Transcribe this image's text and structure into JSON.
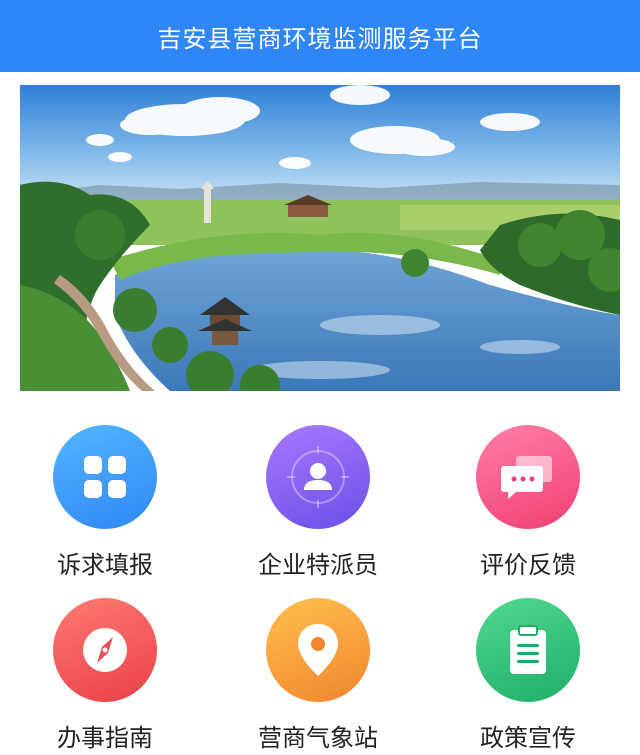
{
  "header": {
    "title": "吉安县营商环境监测服务平台",
    "color": "#2f86f6"
  },
  "banner": {
    "slide_index": 1,
    "slide_count": 1
  },
  "menu": [
    {
      "label": "诉求填报",
      "icon": "grid-icon",
      "color": "#2f86f6"
    },
    {
      "label": "企业特派员",
      "icon": "person-icon",
      "color": "#7b5cf0"
    },
    {
      "label": "评价反馈",
      "icon": "chat-icon",
      "color": "#f0508a"
    },
    {
      "label": "办事指南",
      "icon": "compass-icon",
      "color": "#ee4f55"
    },
    {
      "label": "营商气象站",
      "icon": "location-pin-icon",
      "color": "#f29a3a"
    },
    {
      "label": "政策宣传",
      "icon": "clipboard-icon",
      "color": "#2dbb77"
    }
  ]
}
